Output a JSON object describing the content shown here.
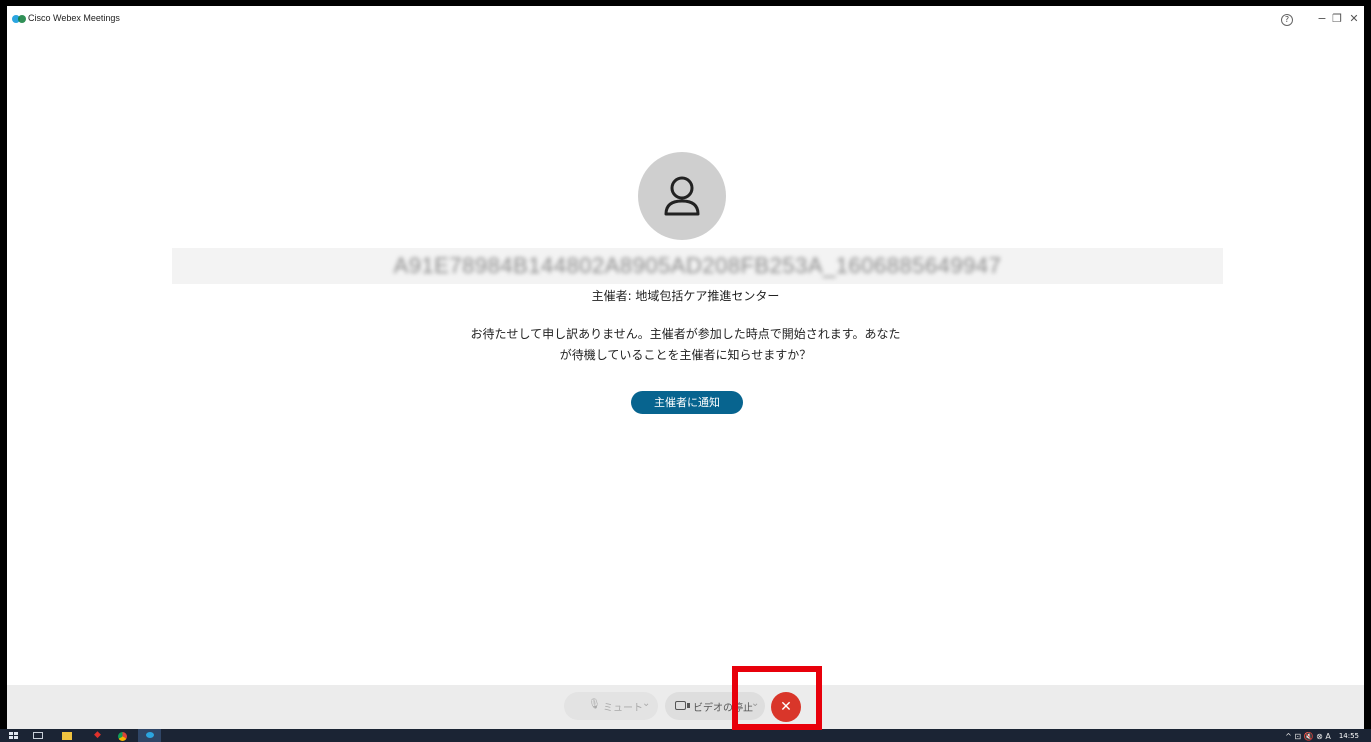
{
  "window": {
    "title": "Cisco Webex Meetings",
    "help_glyph": "?",
    "min_glyph": "−",
    "restore_glyph": "❐",
    "close_glyph": "✕"
  },
  "waiting": {
    "meeting_id": "A91E78984B144802A8905AD208FB253A_1606885649947",
    "host_line": "主催者: 地域包括ケア推進センター",
    "message_line1": "お待たせして申し訳ありません。主催者が参加した時点で開始されます。あなた",
    "message_line2": "が待機していることを主催者に知らせますか？",
    "notify_button": "主催者に通知"
  },
  "toolbar": {
    "mute_label": "ミュート",
    "video_label": "ビデオの停止",
    "leave_glyph": "✕",
    "chevron_glyph": "⌄",
    "mic_glyph": "🎙"
  },
  "colors": {
    "notify_button": "#07648f",
    "leave_button": "#d9362a",
    "highlight_box": "#e8000b",
    "avatar_bg": "#cfcfcf"
  },
  "taskbar": {
    "clock": "14:55",
    "tray_glyphs": "^ ⊡ 🔇 ⊗ A"
  }
}
